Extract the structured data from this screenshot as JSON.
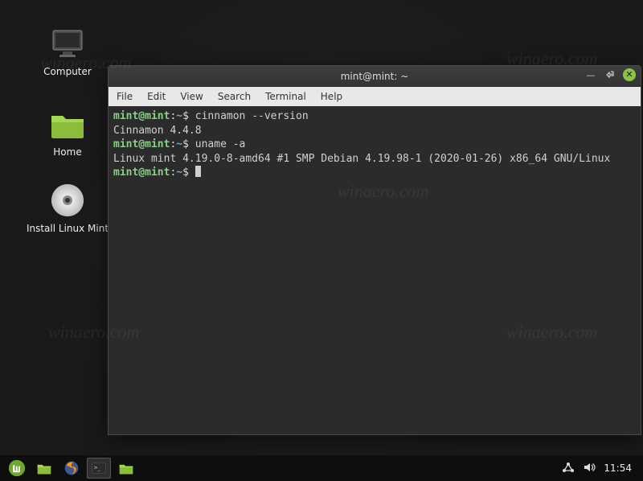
{
  "desktop": {
    "icons": {
      "computer": "Computer",
      "home": "Home",
      "install": "Install Linux Mint"
    }
  },
  "window": {
    "title": "mint@mint: ~",
    "menus": [
      "File",
      "Edit",
      "View",
      "Search",
      "Terminal",
      "Help"
    ]
  },
  "terminal": {
    "prompt_user": "mint@mint",
    "prompt_path": "~",
    "lines": [
      {
        "type": "cmd",
        "command": "cinnamon --version"
      },
      {
        "type": "out",
        "text": "Cinnamon 4.4.8"
      },
      {
        "type": "cmd",
        "command": "uname -a"
      },
      {
        "type": "out",
        "text": "Linux mint 4.19.0-8-amd64 #1 SMP Debian 4.19.98-1 (2020-01-26) x86_64 GNU/Linux"
      },
      {
        "type": "cmd",
        "command": ""
      }
    ]
  },
  "panel": {
    "launchers": [
      {
        "name": "menu",
        "icon": "mint-menu-icon"
      },
      {
        "name": "files",
        "icon": "folder-icon"
      },
      {
        "name": "firefox",
        "icon": "firefox-icon"
      },
      {
        "name": "terminal",
        "icon": "terminal-icon",
        "active": true
      },
      {
        "name": "files-window",
        "icon": "folder-icon"
      }
    ],
    "clock": "11:54"
  },
  "watermark": "winaero.com",
  "colors": {
    "accent": "#8bc34a",
    "term_user": "#89d185",
    "term_path": "#6aa7d8"
  }
}
